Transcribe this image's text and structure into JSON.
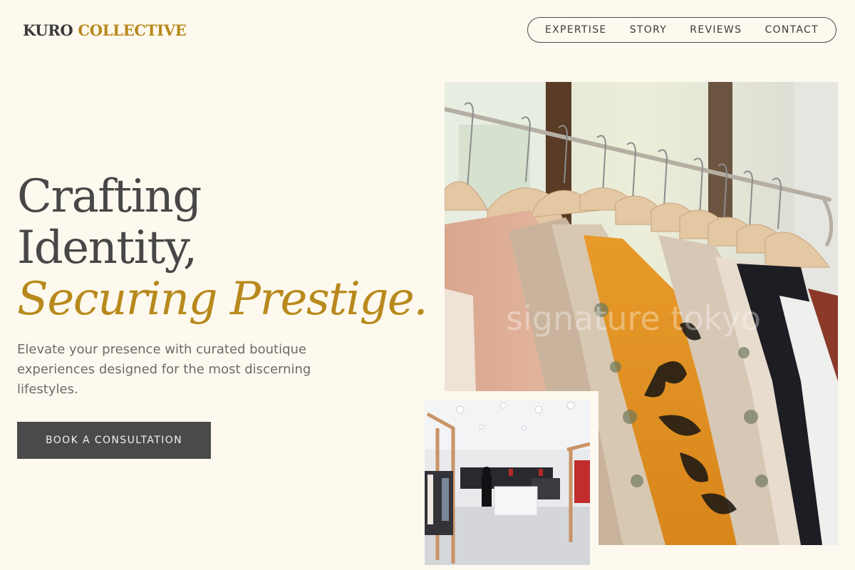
{
  "brand": {
    "name_primary": "KURO",
    "name_accent": "COLLECTIVE"
  },
  "nav": {
    "items": [
      "EXPERTISE",
      "STORY",
      "REVIEWS",
      "CONTACT"
    ]
  },
  "hero": {
    "title_line1": "Crafting",
    "title_line2": "Identity,",
    "title_accent": "Securing Prestige.",
    "subtitle": "Elevate your presence with curated boutique experiences designed for the most discerning lifestyles.",
    "cta_label": "BOOK A CONSULTATION"
  },
  "images": {
    "main_alt": "Clothing rack with garments on wooden hangers",
    "main_watermark": "signature tokyo",
    "store_alt": "Bright boutique store interior"
  },
  "colors": {
    "background": "#fdf9ee",
    "accent": "#b8891c",
    "text_dark": "#474747",
    "button_bg": "#4a4a4a"
  }
}
